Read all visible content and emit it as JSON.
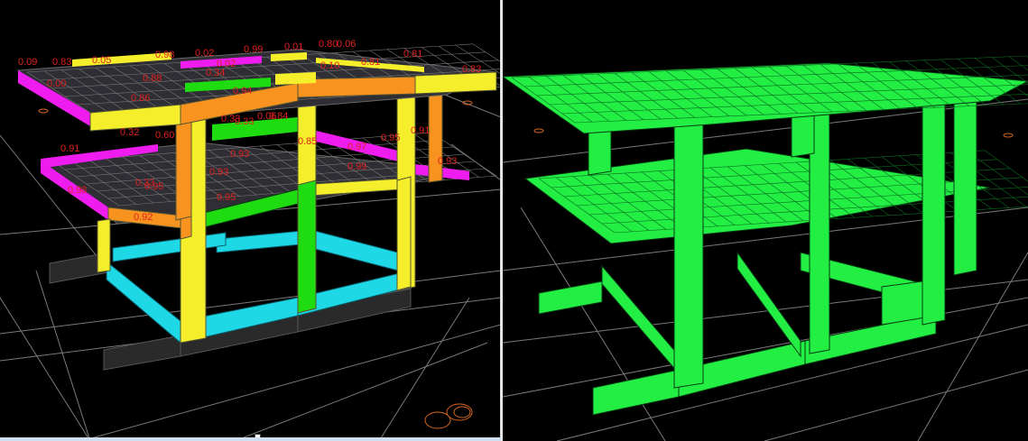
{
  "left_view": {
    "type": "stress-ratio-view",
    "colors": {
      "slab_cell": "#2e2e34",
      "beam_yellow": "#f5ee2a",
      "beam_orange": "#f7931e",
      "beam_magenta": "#ee1cee",
      "beam_green": "#1edc10",
      "beam_cyan": "#1ed8e6",
      "foundation": "#2a2a2a",
      "grid_line": "#8a8a8a",
      "support_ring": "#d4661e",
      "label": "#e02020"
    },
    "ratio_labels": [
      "0.83",
      "0.05",
      "0.98",
      "0.02",
      "0.99",
      "0.01",
      "0.80",
      "0.06",
      "0.81",
      "0.09",
      "0.00",
      "0.88",
      "0.34",
      "0.94",
      "0.02",
      "0.81",
      "0.10",
      "0.33",
      "0.06",
      "0.83",
      "0.86",
      "0.32",
      "0.60",
      "0.33",
      "0.84",
      "0.85",
      "0.91",
      "0.91",
      "0.95",
      "0.97",
      "0.93",
      "0.93",
      "0.33",
      "0.99",
      "0.95",
      "0.93",
      "0.98",
      "0.95",
      "0.92"
    ]
  },
  "right_view": {
    "type": "model-view",
    "colors": {
      "member": "#22ee44",
      "member_edge": "#063a10",
      "grid_line": "#8a8a8a",
      "support_ring": "#d4661e"
    }
  }
}
